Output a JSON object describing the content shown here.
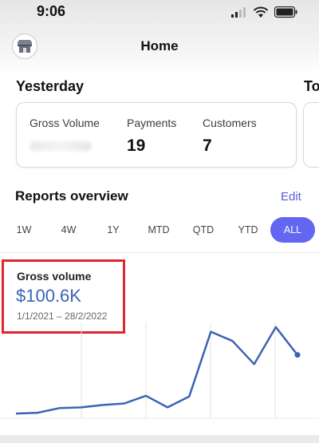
{
  "status_bar": {
    "time": "9:06"
  },
  "nav": {
    "title": "Home",
    "store_icon": "store-icon"
  },
  "yesterday": {
    "title": "Yesterday",
    "next_title_partial": "To",
    "metrics": [
      {
        "label": "Gross Volume",
        "value": ""
      },
      {
        "label": "Payments",
        "value": "19"
      },
      {
        "label": "Customers",
        "value": "7"
      }
    ]
  },
  "reports": {
    "title": "Reports overview",
    "edit_label": "Edit",
    "ranges": [
      "1W",
      "4W",
      "1Y",
      "MTD",
      "QTD",
      "YTD",
      "ALL"
    ],
    "active_range": "ALL",
    "accent_color": "#6366f1"
  },
  "gross_volume": {
    "label": "Gross volume",
    "value": "$100.6K",
    "date_range": "1/1/2021 – 28/2/2022",
    "line_color": "#3b63b5"
  },
  "chart_data": {
    "type": "line",
    "title": "",
    "xlabel": "",
    "ylabel": "",
    "grid": true,
    "series": [
      {
        "values": [
          1.0,
          1.5,
          4.5,
          5.0,
          6.5,
          7.5,
          12.5,
          5.0,
          12.0,
          54.0,
          48.0,
          33.0,
          57.0,
          39.0
        ]
      }
    ],
    "ylim": [
      0,
      60
    ]
  }
}
